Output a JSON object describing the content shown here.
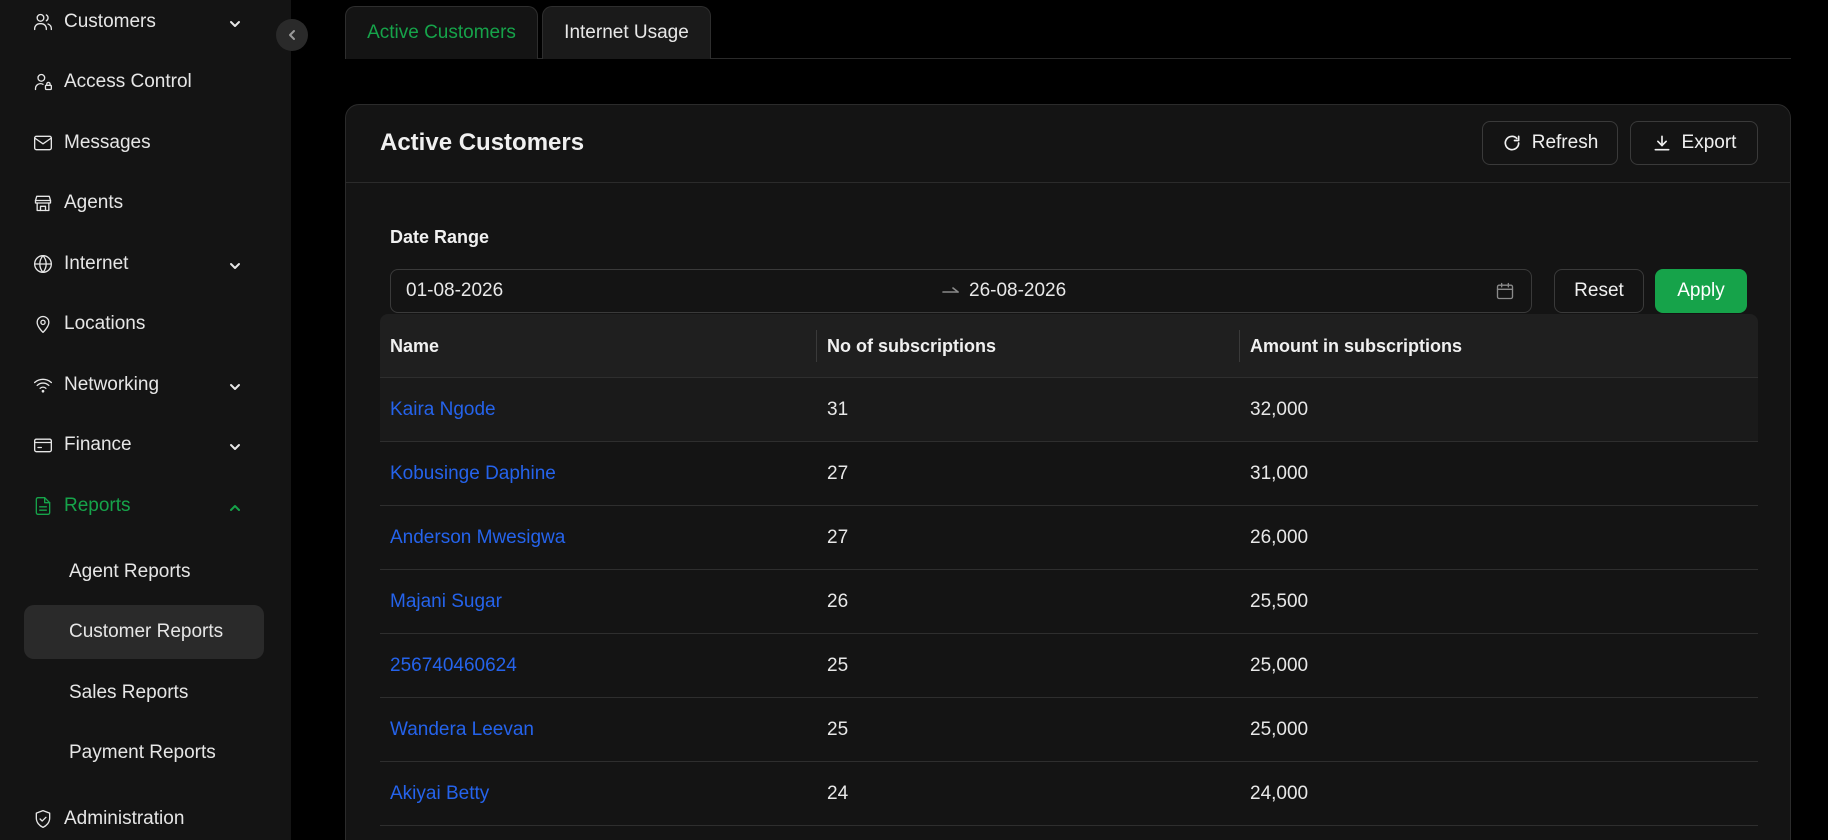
{
  "sidebar": {
    "items": [
      {
        "label": "Customers",
        "icon": "users-icon",
        "expandable": true
      },
      {
        "label": "Access Control",
        "icon": "user-lock-icon",
        "expandable": false
      },
      {
        "label": "Messages",
        "icon": "mail-icon",
        "expandable": false
      },
      {
        "label": "Agents",
        "icon": "store-icon",
        "expandable": false
      },
      {
        "label": "Internet",
        "icon": "globe-icon",
        "expandable": true
      },
      {
        "label": "Locations",
        "icon": "map-pin-icon",
        "expandable": false
      },
      {
        "label": "Networking",
        "icon": "wifi-icon",
        "expandable": true
      },
      {
        "label": "Finance",
        "icon": "wallet-icon",
        "expandable": true
      },
      {
        "label": "Reports",
        "icon": "file-icon",
        "expandable": true,
        "expanded": true
      },
      {
        "label": "Administration",
        "icon": "shield-icon",
        "expandable": false
      }
    ],
    "report_subitems": [
      {
        "label": "Agent Reports"
      },
      {
        "label": "Customer Reports",
        "selected": true
      },
      {
        "label": "Sales Reports"
      },
      {
        "label": "Payment Reports"
      }
    ]
  },
  "tabs": [
    {
      "label": "Active Customers",
      "active": true
    },
    {
      "label": "Internet Usage",
      "active": false
    }
  ],
  "card": {
    "title": "Active Customers",
    "refresh_label": "Refresh",
    "export_label": "Export"
  },
  "filter": {
    "label": "Date Range",
    "start_date": "01-08-2026",
    "end_date": "26-08-2026",
    "reset_label": "Reset",
    "apply_label": "Apply"
  },
  "table": {
    "columns": [
      "Name",
      "No of subscriptions",
      "Amount in subscriptions"
    ],
    "rows": [
      {
        "name": "Kaira Ngode",
        "subscriptions": "31",
        "amount": "32,000"
      },
      {
        "name": "Kobusinge Daphine",
        "subscriptions": "27",
        "amount": "31,000"
      },
      {
        "name": "Anderson Mwesigwa",
        "subscriptions": "27",
        "amount": "26,000"
      },
      {
        "name": "Majani Sugar",
        "subscriptions": "26",
        "amount": "25,500"
      },
      {
        "name": "256740460624",
        "subscriptions": "25",
        "amount": "25,000"
      },
      {
        "name": "Wandera Leevan",
        "subscriptions": "25",
        "amount": "25,000"
      },
      {
        "name": "Akiyai Betty",
        "subscriptions": "24",
        "amount": "24,000"
      }
    ]
  },
  "colors": {
    "accent": "#16a34a",
    "link": "#2563eb",
    "background": "#000000",
    "surface": "#141414"
  }
}
